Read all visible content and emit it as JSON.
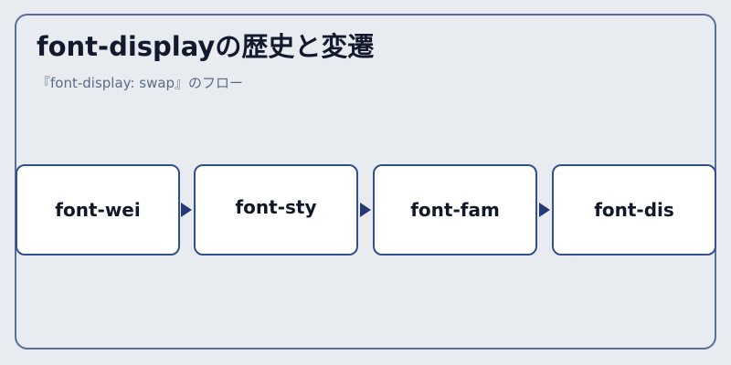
{
  "header": {
    "title": "font-displayの歴史と変遷",
    "subtitle": "『font-display: swap』のフロー"
  },
  "flow": {
    "steps": [
      {
        "label": "font-wei"
      },
      {
        "label": "font-sty"
      },
      {
        "label": "font-fam"
      },
      {
        "label": "font-dis"
      }
    ]
  },
  "colors": {
    "background": "#e8ecf1",
    "frame_border": "#5a6f97",
    "box_border": "#34508a",
    "arrow": "#253a75",
    "title": "#141a2e",
    "subtitle": "#5b6b85"
  }
}
